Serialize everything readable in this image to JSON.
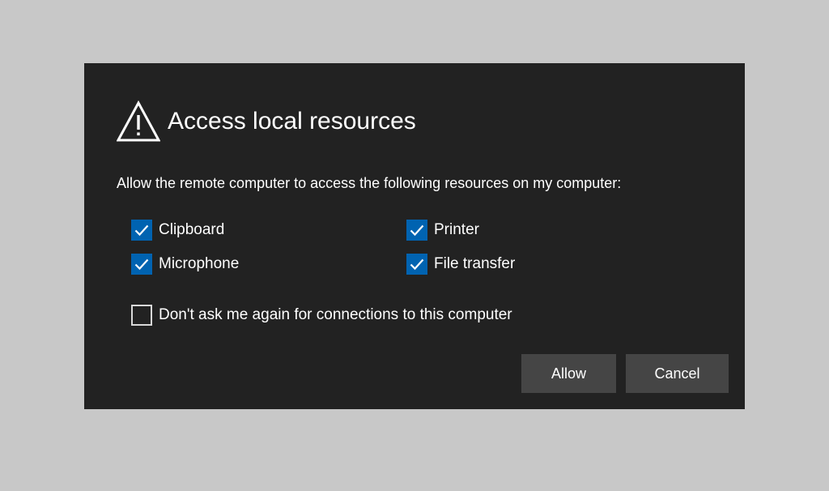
{
  "dialog": {
    "title": "Access local resources",
    "prompt": "Allow the remote computer to access the following resources on my computer:",
    "icon": "warning-icon",
    "resources": {
      "clipboard": {
        "label": "Clipboard",
        "checked": true
      },
      "printer": {
        "label": "Printer",
        "checked": true
      },
      "microphone": {
        "label": "Microphone",
        "checked": true
      },
      "file_transfer": {
        "label": "File transfer",
        "checked": true
      }
    },
    "dont_ask": {
      "label": "Don't ask me again for connections to this computer",
      "checked": false
    },
    "buttons": {
      "allow": "Allow",
      "cancel": "Cancel"
    }
  },
  "colors": {
    "backdrop": "#c8c8c8",
    "dialog_bg": "#222222",
    "checkbox_accent": "#0063b1",
    "button_bg": "#454545",
    "text": "#ffffff"
  }
}
